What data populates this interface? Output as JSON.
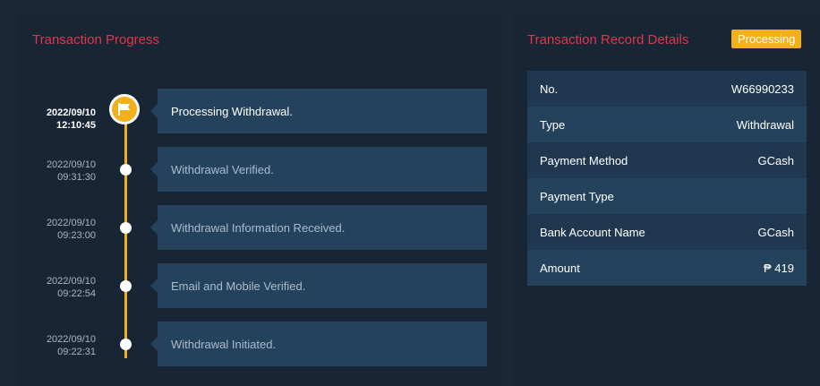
{
  "progress": {
    "title": "Transaction Progress",
    "steps": [
      {
        "date": "2022/09/10",
        "time": "12:10:45",
        "label": "Processing Withdrawal.",
        "active": true
      },
      {
        "date": "2022/09/10",
        "time": "09:31:30",
        "label": "Withdrawal Verified.",
        "active": false
      },
      {
        "date": "2022/09/10",
        "time": "09:23:00",
        "label": "Withdrawal Information Received.",
        "active": false
      },
      {
        "date": "2022/09/10",
        "time": "09:22:54",
        "label": "Email and Mobile Verified.",
        "active": false
      },
      {
        "date": "2022/09/10",
        "time": "09:22:31",
        "label": "Withdrawal Initiated.",
        "active": false
      }
    ],
    "accent_color": "#f3b01b",
    "current_step_icon": "flag-icon"
  },
  "record": {
    "title": "Transaction Record Details",
    "status": "Processing",
    "status_color": "#f3b01b",
    "rows": [
      {
        "label": "No.",
        "value": "W66990233"
      },
      {
        "label": "Type",
        "value": "Withdrawal"
      },
      {
        "label": "Payment Method",
        "value": "GCash"
      },
      {
        "label": "Payment Type",
        "value": ""
      },
      {
        "label": "Bank Account Name",
        "value": "GCash"
      },
      {
        "label": "Amount",
        "value": "₱ 419"
      }
    ]
  },
  "colors": {
    "title_red": "#e0374a",
    "panel_bg": "#172535",
    "card_bg": "#25425c"
  }
}
